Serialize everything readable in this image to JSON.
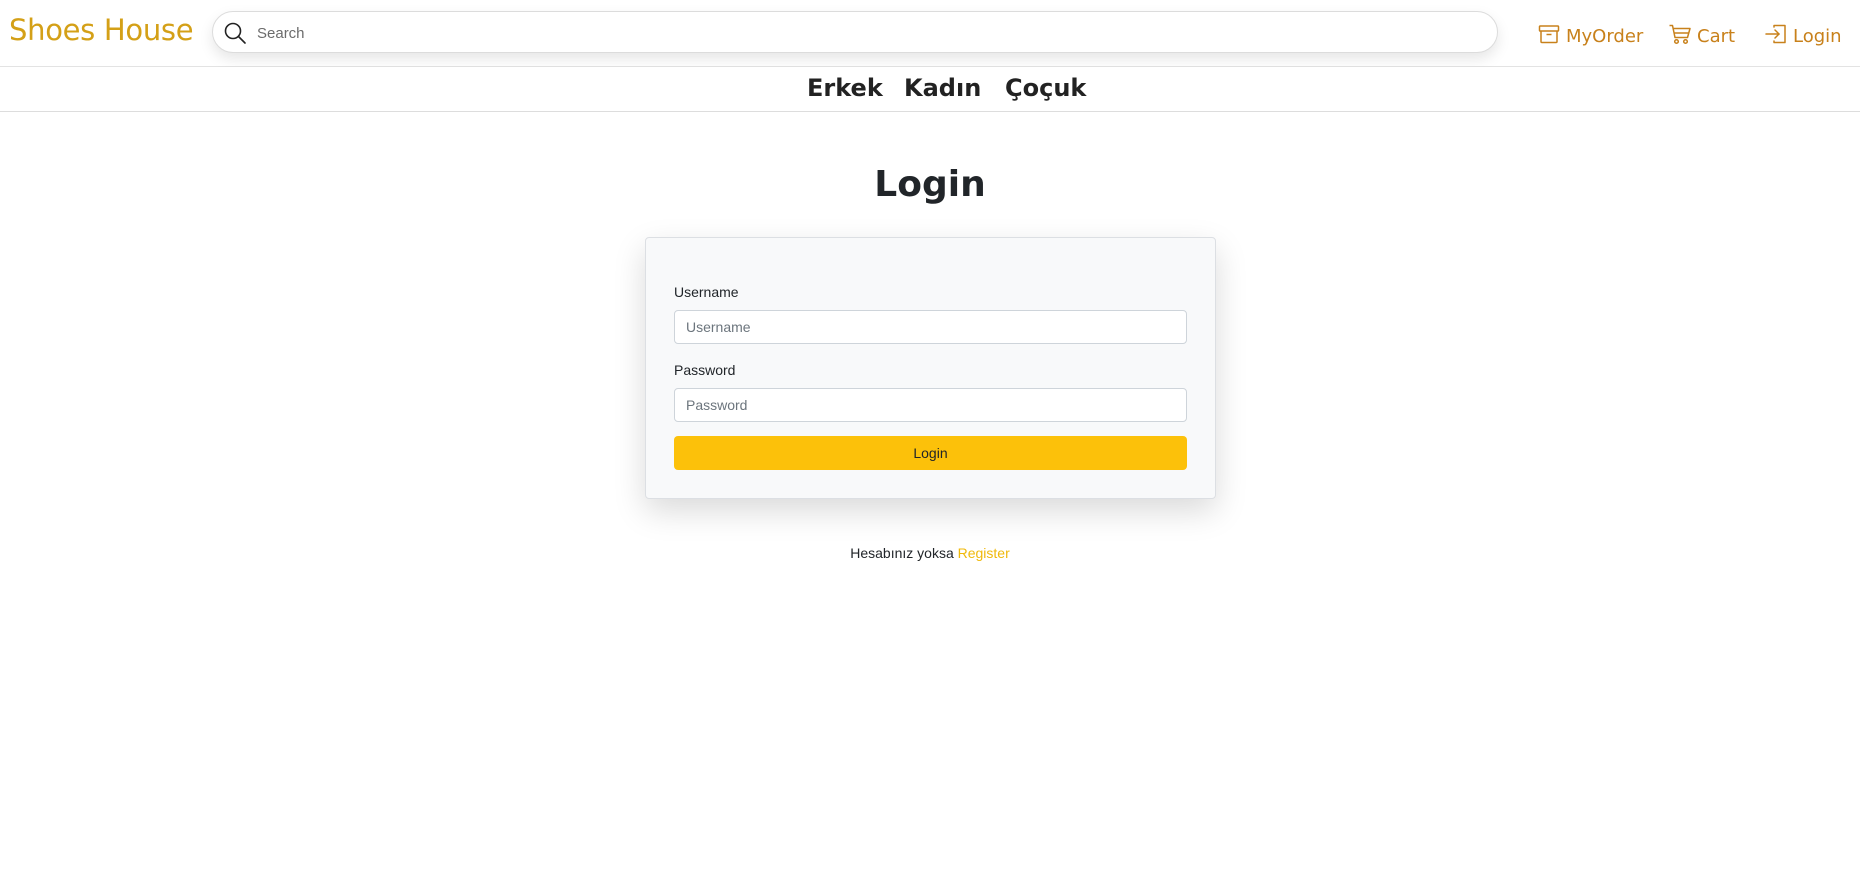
{
  "header": {
    "brand": "Shoes House",
    "search": {
      "placeholder": "Search",
      "value": ""
    },
    "nav": {
      "my_order": "MyOrder",
      "cart": "Cart",
      "login": "Login"
    }
  },
  "categories": [
    "Erkek",
    "Kadın",
    "Çoçuk"
  ],
  "main": {
    "title": "Login",
    "form": {
      "username_label": "Username",
      "username_placeholder": "Username",
      "username_value": "",
      "password_label": "Password",
      "password_placeholder": "Password",
      "password_value": "",
      "submit_label": "Login"
    },
    "register_prompt": "Hesabınız yoksa",
    "register_link": "Register"
  },
  "colors": {
    "brand": "#d4a017",
    "nav_link": "#c8811b",
    "button": "#fcc10a",
    "register_link": "#f0b90b"
  },
  "icons": {
    "search": "search-icon",
    "my_order": "archive-box-icon",
    "cart": "cart-icon",
    "login": "login-arrow-icon"
  }
}
